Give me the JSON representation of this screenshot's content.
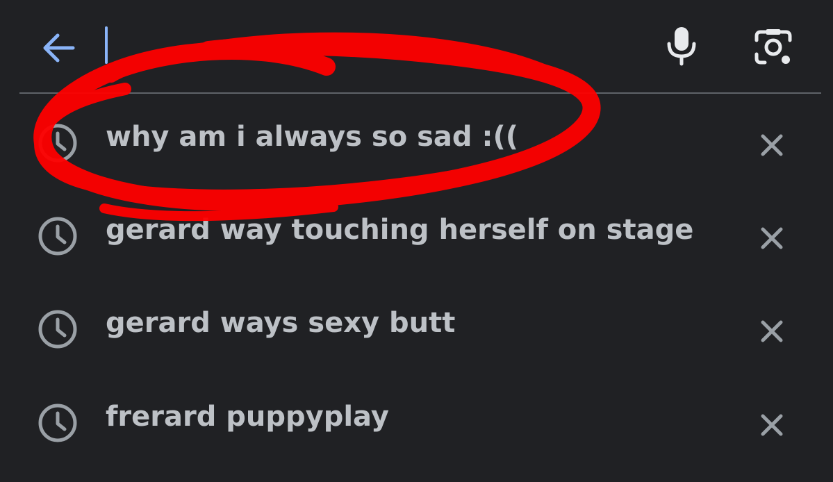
{
  "search": {
    "value": "",
    "back_icon": "arrow-left-icon",
    "mic_icon": "microphone-icon",
    "lens_icon": "camera-lens-icon",
    "accent_color": "#8ab4f8"
  },
  "suggestions": [
    {
      "text": "why am i always so sad :((",
      "icon": "history-clock-icon",
      "remove_icon": "close-icon"
    },
    {
      "text": "gerard way touching herself on stage",
      "icon": "history-clock-icon",
      "remove_icon": "close-icon"
    },
    {
      "text": "gerard ways sexy butt",
      "icon": "history-clock-icon",
      "remove_icon": "close-icon"
    },
    {
      "text": "frerard puppyplay",
      "icon": "history-clock-icon",
      "remove_icon": "close-icon"
    }
  ],
  "annotation": {
    "type": "red-hand-drawn-circle",
    "color": "#ff0000",
    "circles_suggestion": 0
  },
  "theme": {
    "background": "#202124",
    "text_color": "#bdc1c6",
    "icon_color": "#9aa0a6"
  }
}
